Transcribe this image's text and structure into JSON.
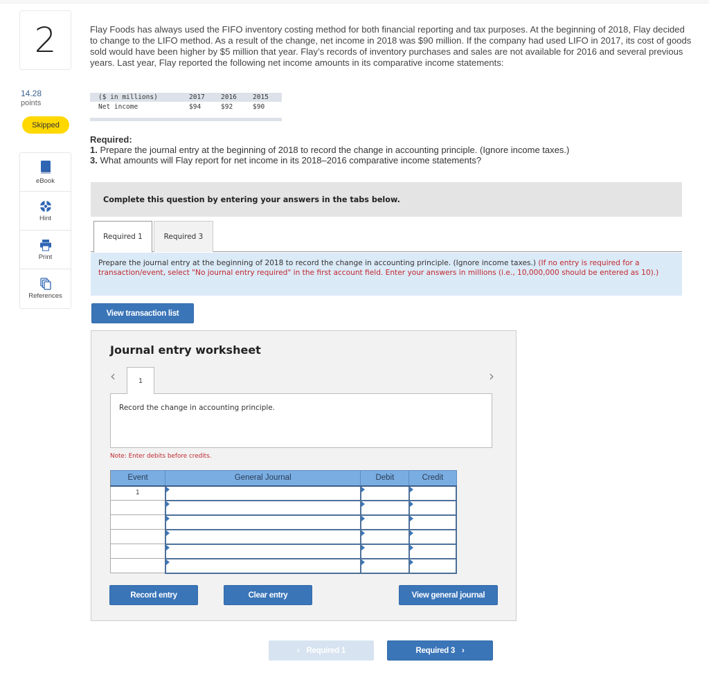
{
  "question": {
    "number": "2",
    "points_value": "14.28",
    "points_label": "points",
    "status_badge": "Skipped",
    "text": "Flay Foods has always used the FIFO inventory costing method for both financial reporting and tax purposes. At the beginning of 2018, Flay decided to change to the LIFO method. As a result of the change, net income in 2018 was $90 million. If the company had used LIFO in 2017, its cost of goods sold would have been higher by $5 million that year. Flay’s records of inventory purchases and sales are not available for 2016 and several previous years. Last year, Flay reported the following net income amounts in its comparative income statements:"
  },
  "sidebar": {
    "tools": [
      {
        "label": "eBook",
        "icon": "book-icon"
      },
      {
        "label": "Hint",
        "icon": "lifebuoy-icon"
      },
      {
        "label": "Print",
        "icon": "printer-icon"
      },
      {
        "label": "References",
        "icon": "copy-documents-icon"
      }
    ]
  },
  "net_income_table": {
    "header": [
      "($ in millions)",
      "2017",
      "2016",
      "2015"
    ],
    "rows": [
      [
        "Net income",
        "$94",
        "$92",
        "$90"
      ]
    ]
  },
  "required": {
    "heading": "Required:",
    "items": [
      {
        "num": "1.",
        "text": " Prepare the journal entry at the beginning of 2018 to record the change in accounting principle. (Ignore income taxes.)"
      },
      {
        "num": "3.",
        "text": " What amounts will Flay report for net income in its 2018–2016 comparative income statements?"
      }
    ]
  },
  "instruction_banner": "Complete this question by entering your answers in the tabs below.",
  "tabs": [
    {
      "label": "Required 1",
      "active": true
    },
    {
      "label": "Required 3",
      "active": false
    }
  ],
  "info": {
    "main": "Prepare the journal entry at the beginning of 2018 to record the change in accounting principle. (Ignore income taxes.) ",
    "red": "(If no entry is required for a transaction/event, select \"No journal entry required\" in the first account field. Enter your answers in millions (i.e., 10,000,000 should be entered as 10).)"
  },
  "buttons": {
    "view_transaction_list": "View transaction list",
    "record_entry": "Record entry",
    "clear_entry": "Clear entry",
    "view_general_journal": "View general journal",
    "prev_required": "Required 1",
    "next_required": "Required 3"
  },
  "worksheet": {
    "title": "Journal entry worksheet",
    "current_tab": "1",
    "prev_icon": "‹",
    "next_icon": "›",
    "description": "Record the change in accounting principle.",
    "note": "Note: Enter debits before credits.",
    "columns": [
      "Event",
      "General Journal",
      "Debit",
      "Credit"
    ],
    "rows": [
      {
        "event": "1",
        "account": "",
        "debit": "",
        "credit": ""
      },
      {
        "event": "",
        "account": "",
        "debit": "",
        "credit": ""
      },
      {
        "event": "",
        "account": "",
        "debit": "",
        "credit": ""
      },
      {
        "event": "",
        "account": "",
        "debit": "",
        "credit": ""
      },
      {
        "event": "",
        "account": "",
        "debit": "",
        "credit": ""
      },
      {
        "event": "",
        "account": "",
        "debit": "",
        "credit": ""
      }
    ]
  },
  "colors": {
    "accent_blue": "#3a75b8",
    "badge_yellow": "#ffd800",
    "warning_red": "#c0282e",
    "table_header_blue": "#7aaee3",
    "info_bg": "#dbeaf7"
  }
}
